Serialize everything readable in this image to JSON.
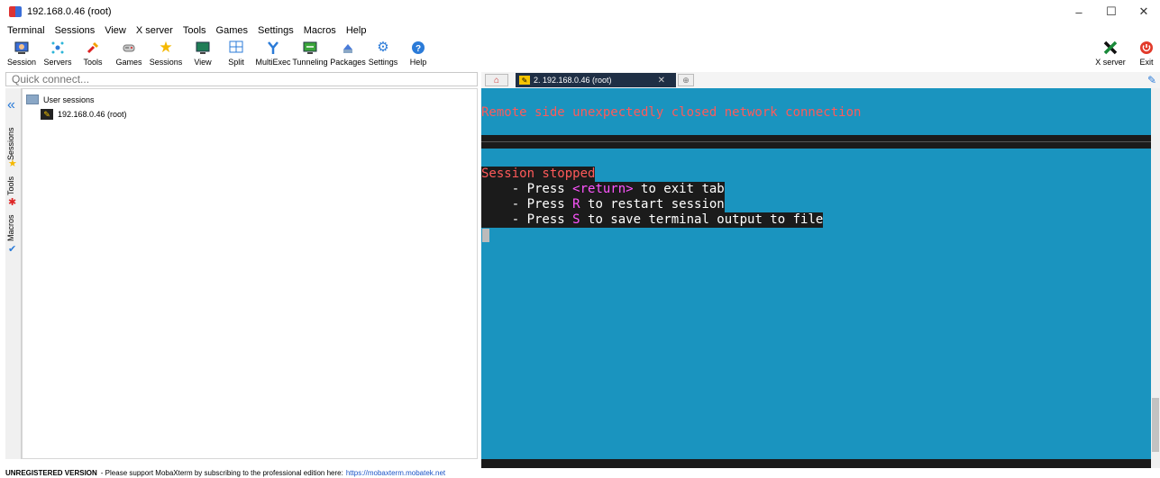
{
  "window": {
    "title": "192.168.0.46 (root)",
    "minimize": "–",
    "maximize": "☐",
    "close": "✕"
  },
  "menu": [
    "Terminal",
    "Sessions",
    "View",
    "X server",
    "Tools",
    "Games",
    "Settings",
    "Macros",
    "Help"
  ],
  "toolbar": [
    {
      "label": "Session",
      "icon": "session-icon"
    },
    {
      "label": "Servers",
      "icon": "servers-icon"
    },
    {
      "label": "Tools",
      "icon": "tools-icon"
    },
    {
      "label": "Games",
      "icon": "games-icon"
    },
    {
      "label": "Sessions",
      "icon": "star-icon"
    },
    {
      "label": "View",
      "icon": "view-icon"
    },
    {
      "label": "Split",
      "icon": "split-icon"
    },
    {
      "label": "MultiExec",
      "icon": "multiexec-icon"
    },
    {
      "label": "Tunneling",
      "icon": "tunneling-icon"
    },
    {
      "label": "Packages",
      "icon": "packages-icon"
    },
    {
      "label": "Settings",
      "icon": "settings-icon"
    },
    {
      "label": "Help",
      "icon": "help-icon"
    }
  ],
  "toolbar_right": [
    {
      "label": "X server",
      "icon": "x-server-icon"
    },
    {
      "label": "Exit",
      "icon": "power-icon"
    }
  ],
  "quick_connect": {
    "placeholder": "Quick connect..."
  },
  "side_tabs": [
    "Sessions",
    "Tools",
    "Macros"
  ],
  "sessions_tree": {
    "folder": "User sessions",
    "items": [
      "192.168.0.46 (root)"
    ]
  },
  "tabs": {
    "active": "2. 192.168.0.46 (root)",
    "close": "✕"
  },
  "terminal": {
    "remote_msg": "Remote side unexpectedly closed network connection",
    "stopped": "Session stopped",
    "press1_pre": "    - Press ",
    "press1_key": "<return>",
    "press1_post": " to exit tab",
    "press2_pre": "    - Press ",
    "press2_key": "R",
    "press2_post": " to restart session",
    "press3_pre": "    - Press ",
    "press3_key": "S",
    "press3_post": " to save terminal output to file"
  },
  "status": {
    "unregistered": "UNREGISTERED VERSION",
    "message": " -  Please support MobaXterm by subscribing to the professional edition here:",
    "link": "https://mobaxterm.mobatek.net"
  },
  "colors": {
    "terminal_bg": "#1a94bf",
    "terminal_text_red": "#ff5a5a",
    "terminal_key": "#ff55ff"
  }
}
